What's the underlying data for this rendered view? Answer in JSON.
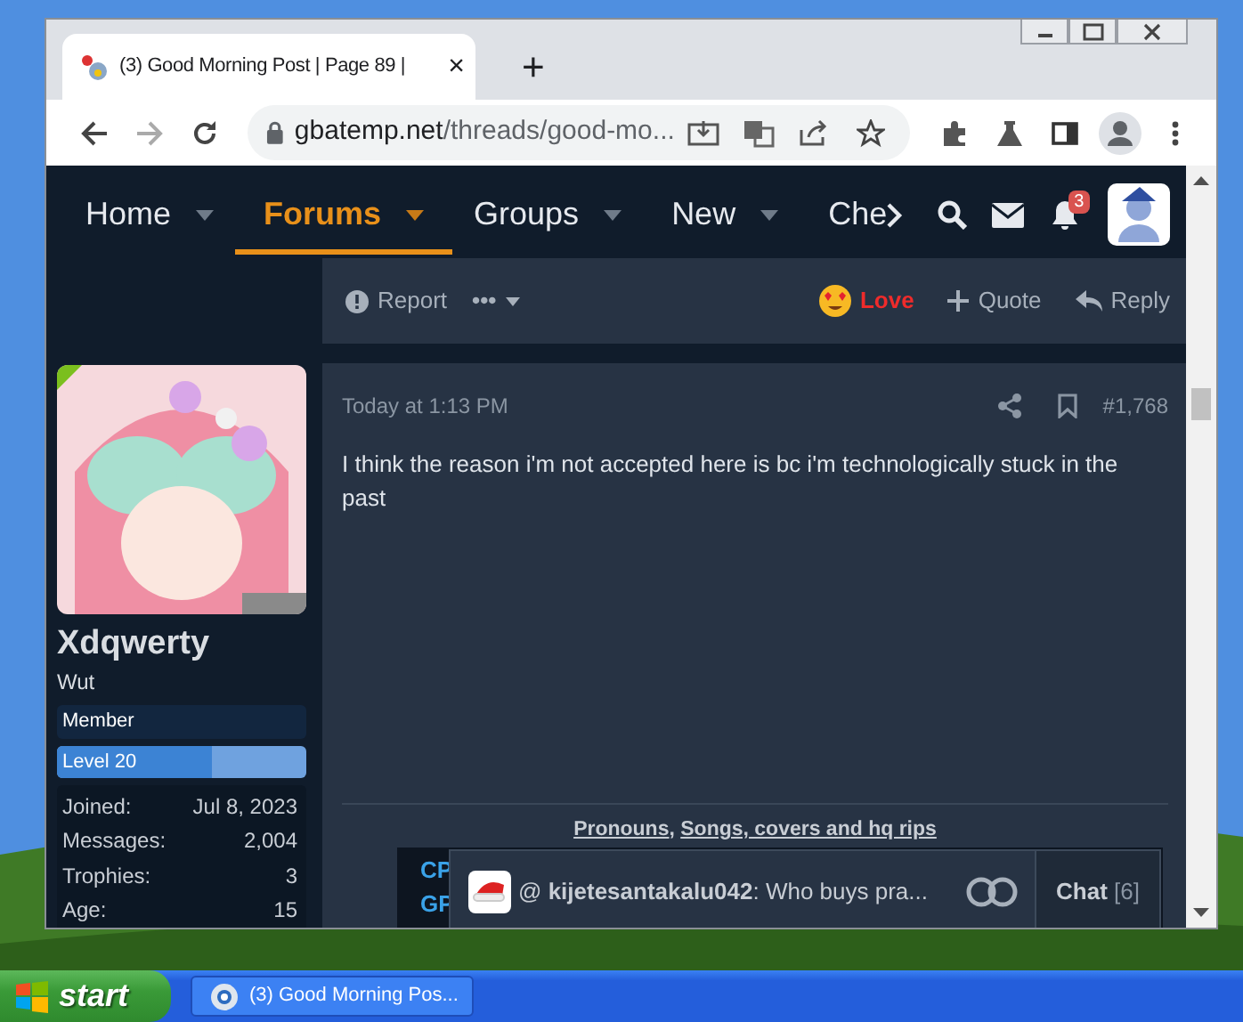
{
  "browser": {
    "tab": {
      "title": "(3) Good Morning Post | Page 89 |",
      "close": "×"
    },
    "new_tab": "+",
    "address": {
      "domain": "gbatemp.net",
      "path": "/threads/good-mo..."
    }
  },
  "nav": {
    "items": [
      {
        "label": "Home",
        "selected": false,
        "dropdown": true
      },
      {
        "label": "Forums",
        "selected": true,
        "dropdown": true
      },
      {
        "label": "Groups",
        "selected": false,
        "dropdown": true
      },
      {
        "label": "New",
        "selected": false,
        "dropdown": true
      },
      {
        "label": "Che",
        "selected": false,
        "dropdown": false
      }
    ],
    "notifications_badge": "3"
  },
  "previous_post_actions": [
    {
      "kind": "report",
      "label": "Report",
      "active": false
    },
    {
      "kind": "more",
      "label": "•••",
      "active": false
    },
    {
      "kind": "react",
      "label": "Love",
      "active": true
    },
    {
      "kind": "quote",
      "label": "Quote",
      "active": false
    },
    {
      "kind": "reply",
      "label": "Reply",
      "active": false
    }
  ],
  "user": {
    "name": "Xdqwerty",
    "title": "Wut",
    "rank": "Member",
    "level_label": "Level 20",
    "level": 0.62,
    "stats": [
      {
        "label": "Joined:",
        "value": "Jul 8, 2023"
      },
      {
        "label": "Messages:",
        "value": "2,004"
      },
      {
        "label": "Trophies:",
        "value": "3"
      },
      {
        "label": "Age:",
        "value": "15"
      }
    ]
  },
  "post": {
    "time": "Today at 1:13 PM",
    "number": "#1,768",
    "text": "I think the reason i'm not accepted here is bc i'm technologically stuck in the past",
    "signature": {
      "links": [
        "Pronouns",
        "Songs, covers and hq rips"
      ],
      "separator": ",",
      "specs": [
        "CP",
        "GP"
      ]
    }
  },
  "chat": {
    "mention": "@",
    "user": "kijetesantakalu042",
    "message": ": Who buys pra...",
    "label": "Chat",
    "count": "[6]"
  },
  "taskbar": {
    "start": "start",
    "windows": [
      {
        "title": "(3) Good Morning Pos...",
        "selected": false
      }
    ]
  }
}
